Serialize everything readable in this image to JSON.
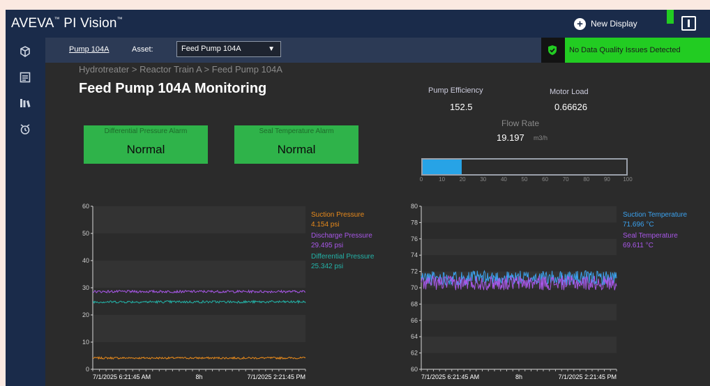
{
  "app": {
    "brand": "AVEVA",
    "product": "PI Vision",
    "new_display_label": "New Display"
  },
  "sidebar": {
    "items": [
      {
        "icon": "cube-icon"
      },
      {
        "icon": "table-icon"
      },
      {
        "icon": "library-icon"
      },
      {
        "icon": "timer-icon"
      }
    ]
  },
  "subbar": {
    "asset_link": "Pump 104A",
    "asset_label": "Asset:",
    "asset_value": "Feed Pump 104A",
    "data_quality": "No Data Quality Issues Detected"
  },
  "main": {
    "breadcrumb": "Hydrotreater > Reactor Train A > Feed Pump 104A",
    "title": "Feed Pump 104A Monitoring",
    "alarms": [
      {
        "label": "Differential Pressure Alarm",
        "value": "Normal"
      },
      {
        "label": "Seal Temperature Alarm",
        "value": "Normal"
      }
    ],
    "kpis": {
      "pump_efficiency_label": "Pump Efficiency",
      "pump_efficiency": "152.5",
      "motor_load_label": "Motor Load",
      "motor_load": "0.66626",
      "flow_rate_label": "Flow Rate",
      "flow_rate": "19.197",
      "flow_rate_unit": "m3/h"
    },
    "flow_gauge": {
      "value": 19.197,
      "min": 0,
      "max": 100,
      "ticks": [
        "0",
        "10",
        "20",
        "30",
        "40",
        "50",
        "60",
        "70",
        "80",
        "90",
        "100"
      ],
      "fill_color": "#27a3e6"
    }
  },
  "chart_data": [
    {
      "type": "line",
      "ylim": [
        0,
        60
      ],
      "yticks": [
        "0",
        "10",
        "20",
        "30",
        "40",
        "50",
        "60"
      ],
      "x_labels": [
        "7/1/2025 6:21:45 AM",
        "8h",
        "7/1/2025 2:21:45 PM"
      ],
      "x_start": "7/1/2025 6:21:45 AM",
      "x_end": "7/1/2025 2:21:45 PM",
      "series": [
        {
          "name": "Suction Pressure",
          "value_label": "4.154 psi",
          "color": "#e88a1b",
          "level": 4.154,
          "noise": 0.35
        },
        {
          "name": "Discharge Pressure",
          "value_label": "29.495 psi",
          "color": "#a857e8",
          "level": 28.6,
          "noise": 0.45
        },
        {
          "name": "Differential Pressure",
          "value_label": "25.342 psi",
          "color": "#23b3a8",
          "level": 24.8,
          "noise": 0.45
        }
      ]
    },
    {
      "type": "line",
      "ylim": [
        60,
        80
      ],
      "yticks": [
        "60",
        "62",
        "64",
        "66",
        "68",
        "70",
        "72",
        "74",
        "76",
        "78",
        "80"
      ],
      "x_labels": [
        "7/1/2025 6:21:45 AM",
        "8h",
        "7/1/2025 2:21:45 PM"
      ],
      "x_start": "7/1/2025 6:21:45 AM",
      "x_end": "7/1/2025 2:21:45 PM",
      "series": [
        {
          "name": "Suction Temperature",
          "value_label": "71.696 °C",
          "color": "#3ba2ef",
          "level": 71.2,
          "noise": 0.9
        },
        {
          "name": "Seal Temperature",
          "value_label": "69.611 °C",
          "color": "#a857e8",
          "level": 70.6,
          "noise": 0.9
        }
      ]
    }
  ]
}
